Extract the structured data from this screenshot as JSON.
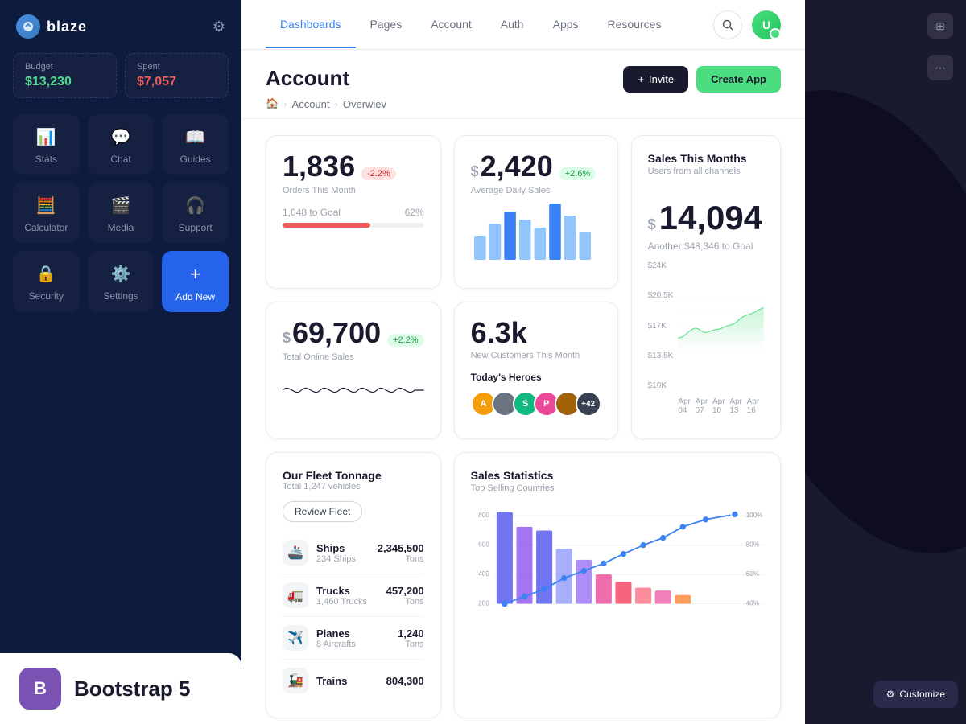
{
  "sidebar": {
    "logo": "blaze",
    "budget": {
      "label": "Budget",
      "value": "$13,230",
      "color": "green"
    },
    "spent": {
      "label": "Spent",
      "value": "$7,057",
      "color": "red"
    },
    "nav_items": [
      {
        "id": "stats",
        "label": "Stats",
        "icon": "📊"
      },
      {
        "id": "chat",
        "label": "Chat",
        "icon": "💬"
      },
      {
        "id": "guides",
        "label": "Guides",
        "icon": "📖"
      },
      {
        "id": "calculator",
        "label": "Calculator",
        "icon": "🧮"
      },
      {
        "id": "media",
        "label": "Media",
        "icon": "🎬"
      },
      {
        "id": "support",
        "label": "Support",
        "icon": "🎧"
      },
      {
        "id": "security",
        "label": "Security",
        "icon": "🔒"
      },
      {
        "id": "settings",
        "label": "Settings",
        "icon": "⚙️"
      },
      {
        "id": "add_new",
        "label": "Add New",
        "icon": "+",
        "active": true
      }
    ]
  },
  "topnav": {
    "links": [
      {
        "id": "dashboards",
        "label": "Dashboards",
        "active": true
      },
      {
        "id": "pages",
        "label": "Pages"
      },
      {
        "id": "account",
        "label": "Account"
      },
      {
        "id": "auth",
        "label": "Auth"
      },
      {
        "id": "apps",
        "label": "Apps"
      },
      {
        "id": "resources",
        "label": "Resources"
      }
    ]
  },
  "page": {
    "title": "Account",
    "breadcrumb": {
      "home": "🏠",
      "parent": "Account",
      "current": "Overwiev"
    },
    "invite_btn": "Invite",
    "create_btn": "Create App"
  },
  "stats": {
    "orders": {
      "number": "1,836",
      "label": "Orders This Month",
      "badge": "-2.2%",
      "badge_type": "red",
      "progress_label": "1,048 to Goal",
      "progress_pct": "62%",
      "progress_val": 62
    },
    "daily_sales": {
      "prefix": "$",
      "number": "2,420",
      "label": "Average Daily Sales",
      "badge": "+2.6%",
      "badge_type": "green"
    },
    "sales_month": {
      "title": "Sales This Months",
      "subtitle": "Users from all channels",
      "prefix": "$",
      "number": "14,094",
      "goal_text": "Another $48,346 to Goal",
      "y_labels": [
        "$24K",
        "$20.5K",
        "$17K",
        "$13.5K",
        "$10K"
      ],
      "x_labels": [
        "Apr 04",
        "Apr 07",
        "Apr 10",
        "Apr 13",
        "Apr 16"
      ]
    },
    "online_sales": {
      "prefix": "$",
      "number": "69,700",
      "badge": "+2.2%",
      "badge_type": "green",
      "label": "Total Online Sales"
    },
    "customers": {
      "number": "6.3k",
      "label": "New Customers This Month",
      "heroes_title": "Today's Heroes",
      "heroes_count": "+42"
    }
  },
  "fleet": {
    "title": "Our Fleet Tonnage",
    "subtitle": "Total 1,247 vehicles",
    "review_btn": "Review Fleet",
    "rows": [
      {
        "icon": "🚢",
        "name": "Ships",
        "count": "234 Ships",
        "value": "2,345,500",
        "unit": "Tons"
      },
      {
        "icon": "🚛",
        "name": "Trucks",
        "count": "1,460 Trucks",
        "value": "457,200",
        "unit": "Tons"
      },
      {
        "icon": "✈️",
        "name": "Planes",
        "count": "8 Aircrafts",
        "value": "1,240",
        "unit": "Tons"
      },
      {
        "icon": "🚂",
        "name": "Trains",
        "count": "",
        "value": "804,300",
        "unit": ""
      }
    ]
  },
  "sales_stats": {
    "title": "Sales Statistics",
    "subtitle": "Top Selling Countries"
  },
  "bootstrap": {
    "icon": "B",
    "text": "Bootstrap 5"
  },
  "customize": {
    "label": "Customize"
  }
}
